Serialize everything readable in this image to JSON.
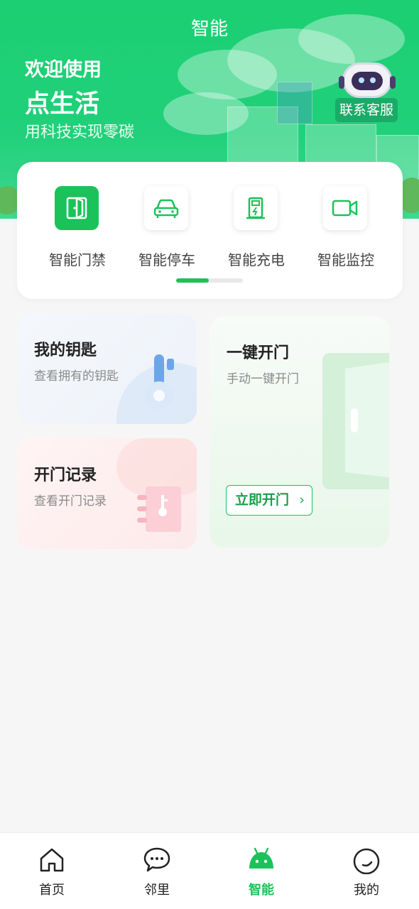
{
  "header": {
    "title": "智能",
    "welcome_line1": "欢迎使用",
    "welcome_line2": "点生活",
    "slogan": "用科技实现零碳",
    "service_label": "联系客服"
  },
  "features": [
    {
      "label": "智能门禁",
      "icon": "door-icon",
      "active": true
    },
    {
      "label": "智能停车",
      "icon": "car-icon",
      "active": false
    },
    {
      "label": "智能充电",
      "icon": "charging-station-icon",
      "active": false
    },
    {
      "label": "智能监控",
      "icon": "video-camera-icon",
      "active": false
    }
  ],
  "tiles": {
    "keys": {
      "title": "我的钥匙",
      "subtitle": "查看拥有的钥匙",
      "icon": "key-icon"
    },
    "records": {
      "title": "开门记录",
      "subtitle": "查看开门记录",
      "icon": "record-book-icon"
    },
    "one_key": {
      "title": "一键开门",
      "subtitle": "手动一键开门",
      "button_label": "立即开门",
      "button_icon": "chevron-right-icon"
    }
  },
  "tabbar": [
    {
      "label": "首页",
      "icon": "home-icon",
      "active": false
    },
    {
      "label": "邻里",
      "icon": "chat-bubble-icon",
      "active": false
    },
    {
      "label": "智能",
      "icon": "android-robot-icon",
      "active": true
    },
    {
      "label": "我的",
      "icon": "smiley-icon",
      "active": false
    }
  ],
  "colors": {
    "brand_green": "#1bc25a",
    "banner_green": "#20d07a",
    "background": "#f6f6f6"
  }
}
